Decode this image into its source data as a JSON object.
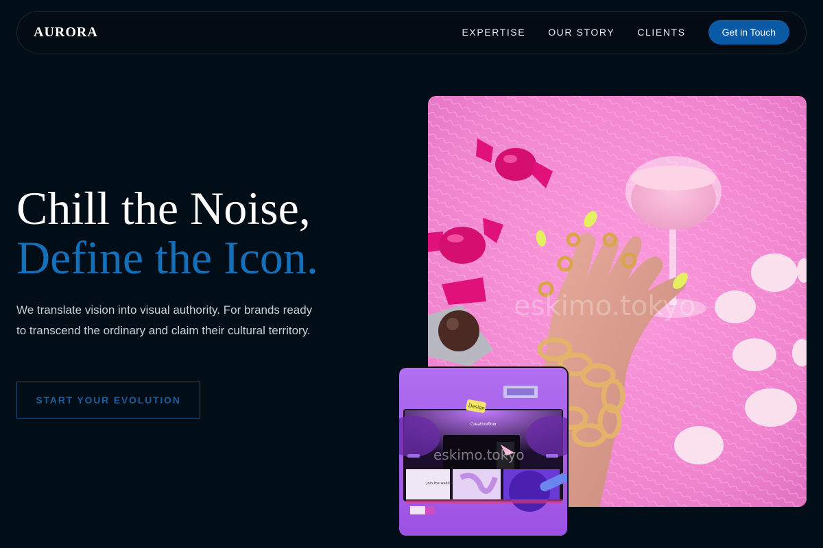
{
  "nav": {
    "logo": "AURORA",
    "links": [
      "EXPERTISE",
      "OUR STORY",
      "CLIENTS"
    ],
    "cta": "Get in Touch"
  },
  "hero": {
    "title_line1": "Chill the Noise,",
    "title_line2": "Define the Icon.",
    "subtitle": "We translate vision into visual authority. For brands ready to transcend the ordinary and claim their cultural territory.",
    "cta": "START YOUR EVOLUTION"
  },
  "media": {
    "main_watermark": "eskimo.tokyo",
    "inset_watermark": "eskimo.tokyo",
    "inset_sticker": "Design",
    "inset_screen_title": "Creativeflow",
    "inset_screen_text": "Join the waitlist"
  },
  "colors": {
    "background": "#020e17",
    "accent": "#1371bb",
    "button": "#0a5aa6",
    "pink": "#f48ad2",
    "purple": "#a45ce8"
  }
}
